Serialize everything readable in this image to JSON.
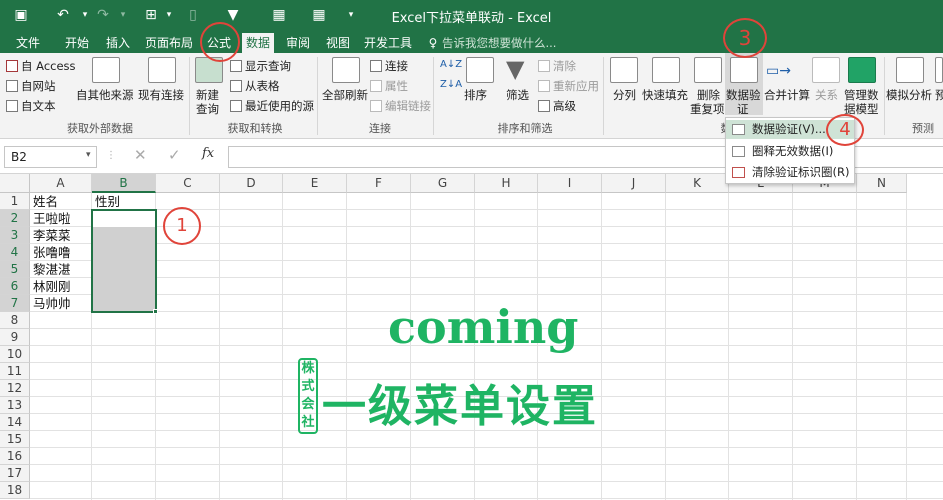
{
  "window": {
    "title": "Excel下拉菜单联动 - Excel"
  },
  "tabs": [
    "文件",
    "开始",
    "插入",
    "页面布局",
    "公式",
    "数据",
    "审阅",
    "视图",
    "开发工具"
  ],
  "tell_me": "告诉我您想要做什么...",
  "ribbon": {
    "get_external": {
      "access": "自 Access",
      "web": "自网站",
      "text": "自文本",
      "other": "自其他来源",
      "existing": "现有连接",
      "label": "获取外部数据"
    },
    "get_transform": {
      "new_query": "新建",
      "new_query2": "查询",
      "show_queries": "显示查询",
      "from_table": "从表格",
      "recent": "最近使用的源",
      "label": "获取和转换"
    },
    "connections": {
      "refresh_all": "全部刷新",
      "connections": "连接",
      "properties": "属性",
      "edit_links": "编辑链接",
      "label": "连接"
    },
    "sort_filter": {
      "sort": "排序",
      "filter": "筛选",
      "clear": "清除",
      "reapply": "重新应用",
      "advanced": "高级",
      "label": "排序和筛选"
    },
    "data_tools": {
      "text_to_columns": "分列",
      "flash_fill": "快速填充",
      "remove_dup1": "删除",
      "remove_dup2": "重复项",
      "validation1": "数据验",
      "validation2": "证",
      "consolidate": "合并计算",
      "relationships": "关系",
      "data_model1": "管理数",
      "data_model2": "据模型",
      "label": "数"
    },
    "forecast": {
      "what_if": "模拟分析",
      "forecast": "预",
      "label": "预测"
    }
  },
  "formula_bar": {
    "name_box": "B2",
    "fx": "fx",
    "formula": ""
  },
  "dropdown": {
    "items": [
      "数据验证(V)...",
      "圈释无效数据(I)",
      "清除验证标识圈(R)"
    ]
  },
  "grid": {
    "columns": [
      "A",
      "B",
      "C",
      "D",
      "E",
      "F",
      "G",
      "H",
      "I",
      "J",
      "K",
      "L",
      "M",
      "N"
    ],
    "rows": [
      "1",
      "2",
      "3",
      "4",
      "5",
      "6",
      "7",
      "8",
      "9",
      "10",
      "11",
      "12",
      "13",
      "14",
      "15",
      "16",
      "17",
      "18"
    ],
    "A": [
      "姓名",
      "王啦啦",
      "李菜菜",
      "张噜噜",
      "黎湛湛",
      "林刚刚",
      "马帅帅"
    ],
    "B1": "性别"
  },
  "callouts": [
    "1",
    "3",
    "4"
  ],
  "watermark": {
    "line1": "coming",
    "line2": "一级菜单设置",
    "seal": [
      "株",
      "式",
      "会",
      "社"
    ]
  },
  "colors": {
    "excel_green": "#217346",
    "callout_red": "#e0443a",
    "watermark_green": "#1fb463"
  }
}
